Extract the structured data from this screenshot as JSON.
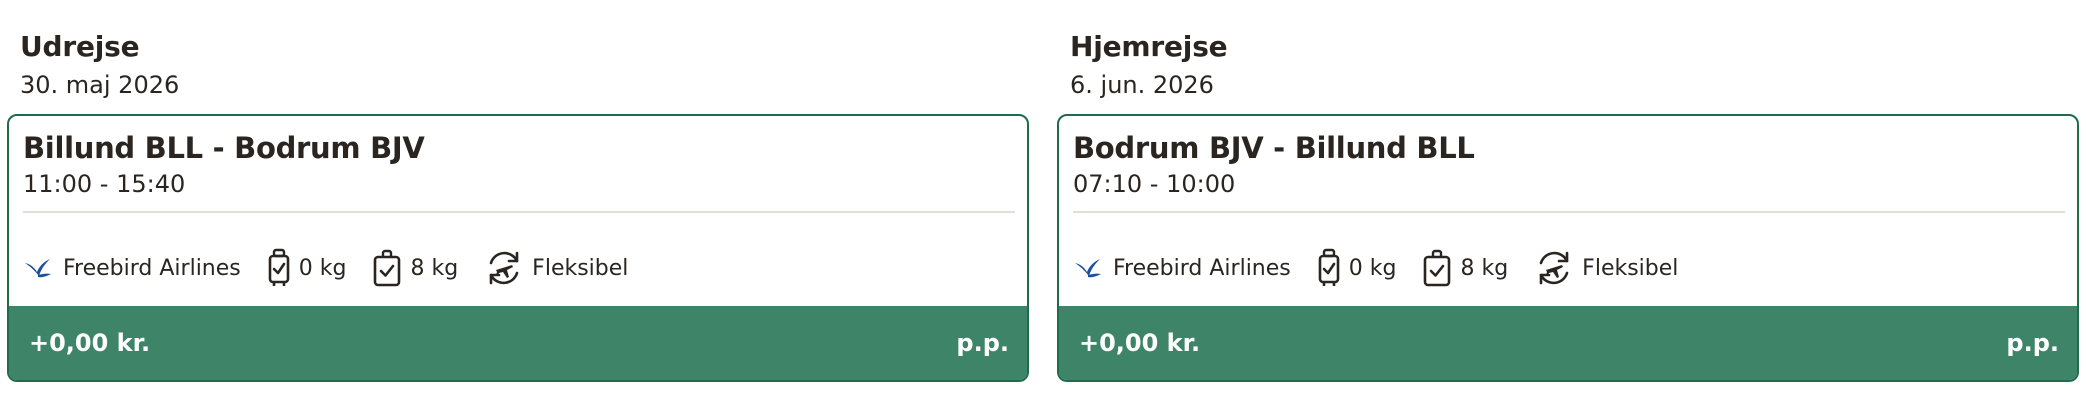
{
  "colors": {
    "accent_green": "#3d8468",
    "border_green": "#1f6b4b",
    "text": "#2a2520",
    "divider": "#e4ded3",
    "airline_logo": "#1c4fa0"
  },
  "outbound": {
    "heading": "Udrejse",
    "date": "30. maj 2026",
    "route": "Billund BLL - Bodrum BJV",
    "times": "11:00 - 15:40",
    "airline": "Freebird Airlines",
    "airline_icon": "freebird-logo-icon",
    "hand_luggage": "0 kg",
    "hand_luggage_icon": "suitcase-check-icon",
    "checked_luggage": "8 kg",
    "checked_luggage_icon": "bag-check-icon",
    "flexible": "Fleksibel",
    "flexible_icon": "flexible-flight-icon",
    "price": "+0,00 kr.",
    "per_person": "p.p."
  },
  "return": {
    "heading": "Hjemrejse",
    "date": "6. jun. 2026",
    "route": "Bodrum BJV - Billund BLL",
    "times": "07:10 - 10:00",
    "airline": "Freebird Airlines",
    "airline_icon": "freebird-logo-icon",
    "hand_luggage": "0 kg",
    "hand_luggage_icon": "suitcase-check-icon",
    "checked_luggage": "8 kg",
    "checked_luggage_icon": "bag-check-icon",
    "flexible": "Fleksibel",
    "flexible_icon": "flexible-flight-icon",
    "price": "+0,00 kr.",
    "per_person": "p.p."
  }
}
